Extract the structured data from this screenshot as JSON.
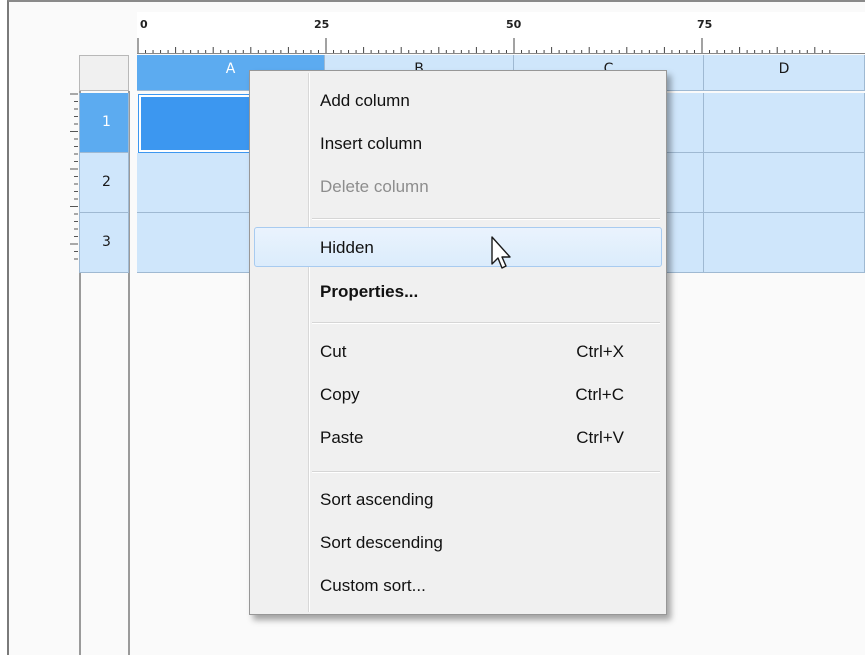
{
  "ruler": {
    "ticks": [
      "0",
      "25",
      "50",
      "75"
    ]
  },
  "columns": [
    {
      "label": "A",
      "selected": true
    },
    {
      "label": "B",
      "selected": false
    },
    {
      "label": "C",
      "selected": false
    },
    {
      "label": "D",
      "selected": false
    }
  ],
  "rows": [
    {
      "label": "1",
      "selected": true
    },
    {
      "label": "2",
      "selected": false
    },
    {
      "label": "3",
      "selected": false
    }
  ],
  "context_menu": {
    "items": [
      {
        "label": "Add column",
        "shortcut": "",
        "state": "normal"
      },
      {
        "label": "Insert column",
        "shortcut": "",
        "state": "normal"
      },
      {
        "label": "Delete column",
        "shortcut": "",
        "state": "disabled"
      },
      {
        "label": "Hidden",
        "shortcut": "",
        "state": "hover"
      },
      {
        "label": "Properties...",
        "shortcut": "",
        "state": "bold"
      },
      {
        "label": "Cut",
        "shortcut": "Ctrl+X",
        "state": "normal"
      },
      {
        "label": "Copy",
        "shortcut": "Ctrl+C",
        "state": "normal"
      },
      {
        "label": "Paste",
        "shortcut": "Ctrl+V",
        "state": "normal"
      },
      {
        "label": "Sort ascending",
        "shortcut": "",
        "state": "normal"
      },
      {
        "label": "Sort descending",
        "shortcut": "",
        "state": "normal"
      },
      {
        "label": "Custom sort...",
        "shortcut": "",
        "state": "normal"
      }
    ]
  },
  "colors": {
    "selection": "#5cabf0",
    "active_cell": "#3c97f0",
    "cell_background": "#cfe6fb",
    "menu_background": "#f0f0f0",
    "hover_highlight": "#dbecfc"
  }
}
